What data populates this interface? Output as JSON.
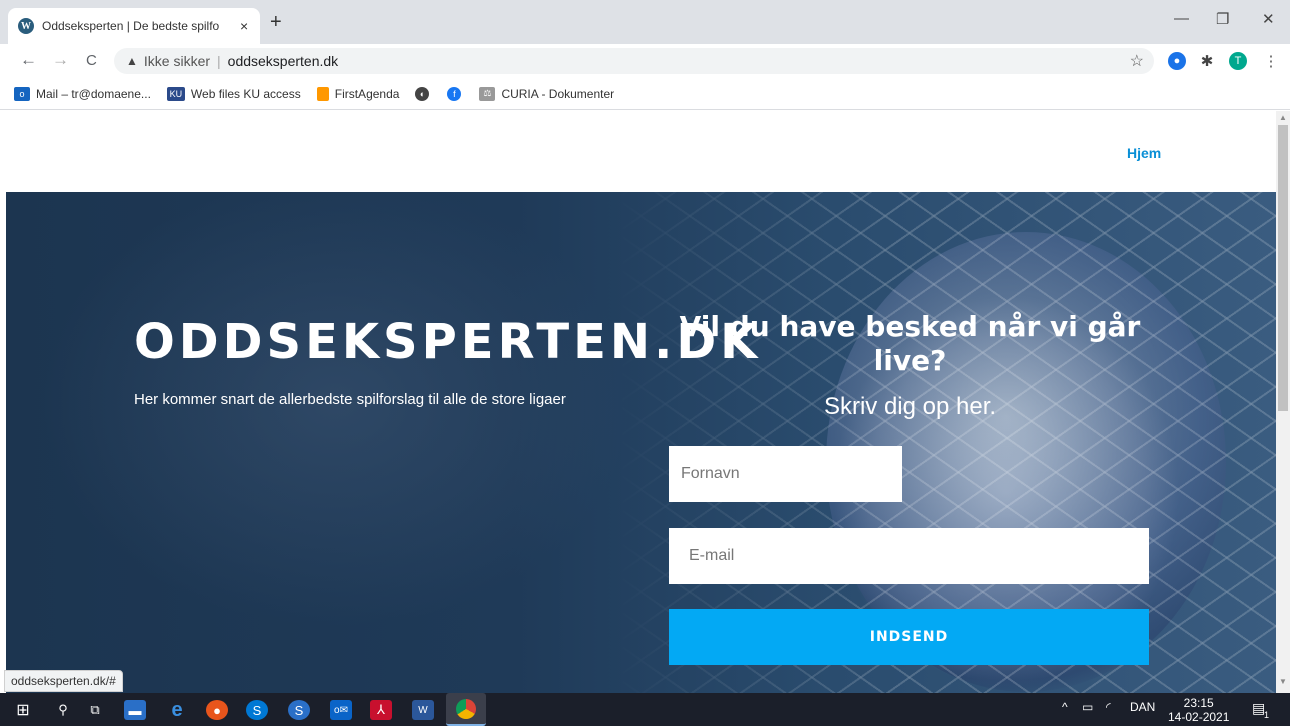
{
  "browser": {
    "tab_title": "Oddseksperten | De bedste spilfo",
    "tab_favicon": "wordpress-icon",
    "tab_close": "×",
    "new_tab": "+",
    "window_controls": [
      "—",
      "❐",
      "✕"
    ],
    "back": "←",
    "forward": "→",
    "reload": "C",
    "security_label": "Ikke sikker",
    "url": "oddseksperten.dk",
    "bookmarks": [
      {
        "label": "Mail – tr@domaene...",
        "icon": "outlook-icon",
        "color": "#1565c0"
      },
      {
        "label": "Web files KU access",
        "icon": "ku-icon",
        "color": "#2b4a8a"
      },
      {
        "label": "FirstAgenda",
        "icon": "firstagenda-icon",
        "color": "#ff9800"
      },
      {
        "label": "",
        "icon": "globe-icon",
        "color": "#5f6368"
      },
      {
        "label": "",
        "icon": "facebook-icon",
        "color": "#1877f2"
      },
      {
        "label": "CURIA - Dokumenter",
        "icon": "curia-icon",
        "color": "#888888"
      }
    ],
    "profile_initial": "T"
  },
  "page": {
    "nav_home": "Hjem",
    "brand": "ODDSEKSPERTEN.DK",
    "tagline": "Her kommer snart de allerbedste spilforslag til alle de store ligaer",
    "form_heading": "Vil du have besked når vi går live?",
    "form_subheading": "Skriv dig op her.",
    "firstname_placeholder": "Fornavn",
    "email_placeholder": "E-mail",
    "submit_label": "INDSEND",
    "accent": "#03a9f4"
  },
  "status_bar": "oddseksperten.dk/#",
  "taskbar": {
    "language": "DAN",
    "time": "23:15",
    "date": "14-02-2021",
    "notification_count": "1"
  }
}
